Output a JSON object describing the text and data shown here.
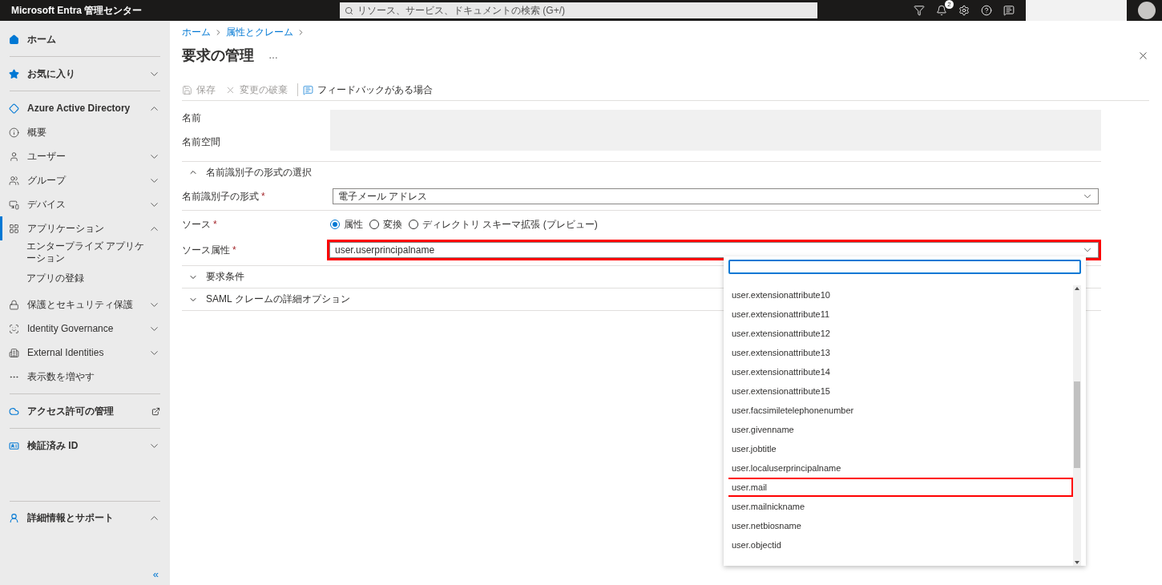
{
  "topbar": {
    "title": "Microsoft Entra 管理センター",
    "search": {
      "placeholder": "リソース、サービス、ドキュメントの検索 (G+/)"
    },
    "notification_count": "2"
  },
  "sidebar": {
    "sections": [
      {
        "kind": "link",
        "label": "ホーム"
      },
      {
        "kind": "collapsible",
        "label": "お気に入り",
        "expanded": false
      },
      {
        "kind": "collapsible",
        "label": "Azure Active Directory",
        "expanded": true,
        "children": [
          {
            "kind": "link",
            "label": "概要",
            "selected": false
          },
          {
            "kind": "collapsible",
            "label": "ユーザー",
            "expanded": false,
            "selected": false
          },
          {
            "kind": "collapsible",
            "label": "グループ",
            "expanded": false,
            "selected": false
          },
          {
            "kind": "collapsible",
            "label": "デバイス",
            "expanded": false,
            "selected": false
          },
          {
            "kind": "collapsible",
            "label": "アプリケーション",
            "expanded": true,
            "selected": true,
            "children": [
              {
                "label": "エンタープライズ アプリケーション"
              },
              {
                "label": "アプリの登録"
              }
            ]
          },
          {
            "kind": "collapsible",
            "label": "保護とセキュリティ保護",
            "expanded": false,
            "selected": false
          },
          {
            "kind": "collapsible",
            "label": "Identity Governance",
            "expanded": false,
            "selected": false
          },
          {
            "kind": "collapsible",
            "label": "External Identities",
            "expanded": false,
            "selected": false
          },
          {
            "kind": "more",
            "label": "表示数を増やす",
            "selected": false
          }
        ]
      },
      {
        "kind": "external",
        "label": "アクセス許可の管理"
      },
      {
        "kind": "collapsible",
        "label": "検証済み ID",
        "expanded": false
      }
    ],
    "footer": {
      "label": "詳細情報とサポート",
      "expanded": true,
      "collapse": "«"
    }
  },
  "breadcrumb": [
    "ホーム",
    "属性とクレーム"
  ],
  "page": {
    "title": "要求の管理",
    "more": "…"
  },
  "toolbar": [
    {
      "kind": "save",
      "label": "保存",
      "disabled": true
    },
    {
      "kind": "discard",
      "label": "変更の破棄",
      "disabled": true
    },
    {
      "kind": "feedback",
      "label": "フィードバックがある場合",
      "disabled": false
    }
  ],
  "form": {
    "name_label": "名前",
    "namespace_label": "名前空間",
    "format_section": {
      "label": "名前識別子の形式の選択",
      "expanded": true
    },
    "format": {
      "label": "名前識別子の形式",
      "required_mark": "*",
      "value": "電子メール アドレス"
    },
    "source": {
      "label": "ソース",
      "required_mark": "*",
      "options": [
        {
          "label": "属性",
          "selected": true
        },
        {
          "label": "変換",
          "selected": false
        },
        {
          "label": "ディレクトリ スキーマ拡張 (プレビュー)",
          "selected": false
        }
      ]
    },
    "source_attribute": {
      "label": "ソース属性",
      "required_mark": "*",
      "value": "user.userprincipalname",
      "highlighted": true,
      "open": true
    },
    "sections": [
      {
        "label": "要求条件",
        "expanded": false
      },
      {
        "label": "SAML クレームの詳細オプション",
        "expanded": false
      }
    ]
  },
  "dropdown": {
    "items": [
      {
        "label": "user.extensionattribute10",
        "highlighted": false
      },
      {
        "label": "user.extensionattribute11",
        "highlighted": false
      },
      {
        "label": "user.extensionattribute12",
        "highlighted": false
      },
      {
        "label": "user.extensionattribute13",
        "highlighted": false
      },
      {
        "label": "user.extensionattribute14",
        "highlighted": false
      },
      {
        "label": "user.extensionattribute15",
        "highlighted": false
      },
      {
        "label": "user.facsimiletelephonenumber",
        "highlighted": false
      },
      {
        "label": "user.givenname",
        "highlighted": false
      },
      {
        "label": "user.jobtitle",
        "highlighted": false
      },
      {
        "label": "user.localuserprincipalname",
        "highlighted": false
      },
      {
        "label": "user.mail",
        "highlighted": true
      },
      {
        "label": "user.mailnickname",
        "highlighted": false
      },
      {
        "label": "user.netbiosname",
        "highlighted": false
      },
      {
        "label": "user.objectid",
        "highlighted": false
      }
    ]
  }
}
